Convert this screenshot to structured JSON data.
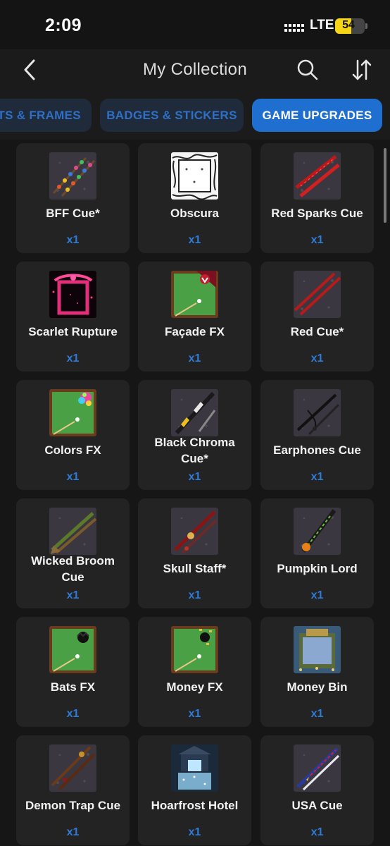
{
  "status": {
    "time": "2:09",
    "network": "LTE",
    "battery": "54",
    "battery_level": 0.54
  },
  "nav": {
    "title": "My Collection",
    "back_icon": "chevron-left-icon",
    "search_icon": "search-icon",
    "sort_icon": "sort-icon"
  },
  "tabs": [
    {
      "label": "ATS & FRAMES",
      "active": false
    },
    {
      "label": "BADGES & STICKERS",
      "active": false
    },
    {
      "label": "GAME UPGRADES",
      "active": true
    }
  ],
  "colors": {
    "accent": "#1f6fd1",
    "quantity": "#2e7bd8",
    "card": "#232323",
    "battery": "#f5d516"
  },
  "items": [
    {
      "name": "BFF Cue*",
      "qty": "x1",
      "kind": "cue-beads"
    },
    {
      "name": "Obscura",
      "qty": "x1",
      "kind": "frame-white"
    },
    {
      "name": "Red Sparks Cue",
      "qty": "x1",
      "kind": "cue-red"
    },
    {
      "name": "Scarlet Rupture",
      "qty": "x1",
      "kind": "frame-red"
    },
    {
      "name": "Façade FX",
      "qty": "x1",
      "kind": "fx-facade"
    },
    {
      "name": "Red Cue*",
      "qty": "x1",
      "kind": "cue-redplain"
    },
    {
      "name": "Colors FX",
      "qty": "x1",
      "kind": "fx-colors"
    },
    {
      "name": "Black Chroma Cue*",
      "qty": "x1",
      "kind": "cue-chroma"
    },
    {
      "name": "Earphones Cue",
      "qty": "x1",
      "kind": "cue-earphones"
    },
    {
      "name": "Wicked Broom Cue",
      "qty": "x1",
      "kind": "cue-broom"
    },
    {
      "name": "Skull Staff*",
      "qty": "x1",
      "kind": "cue-skull"
    },
    {
      "name": "Pumpkin Lord",
      "qty": "x1",
      "kind": "cue-pumpkin"
    },
    {
      "name": "Bats FX",
      "qty": "x1",
      "kind": "fx-bats"
    },
    {
      "name": "Money FX",
      "qty": "x1",
      "kind": "fx-money"
    },
    {
      "name": "Money Bin",
      "qty": "x1",
      "kind": "table-bin"
    },
    {
      "name": "Demon Trap Cue",
      "qty": "x1",
      "kind": "cue-demon"
    },
    {
      "name": "Hoarfrost Hotel",
      "qty": "x1",
      "kind": "table-hotel"
    },
    {
      "name": "USA Cue",
      "qty": "x1",
      "kind": "cue-usa"
    }
  ]
}
